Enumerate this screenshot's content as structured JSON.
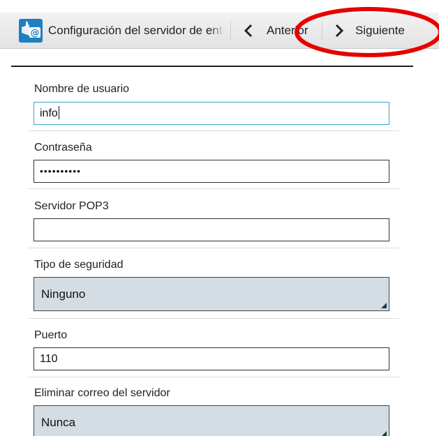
{
  "actionbar": {
    "title": "Configuración del servidor de entrada",
    "prev_label": "Anterior",
    "next_label": "Siguiente",
    "icon": "email-settings-icon"
  },
  "form": {
    "username": {
      "label": "Nombre de usuario",
      "value": "info"
    },
    "password": {
      "label": "Contraseña",
      "value": "••••••••••"
    },
    "server": {
      "label": "Servidor POP3",
      "value": ""
    },
    "security": {
      "label": "Tipo de seguridad",
      "value": "Ninguno"
    },
    "port": {
      "label": "Puerto",
      "value": "110"
    },
    "delete": {
      "label": "Eliminar correo del servidor",
      "value": "Nunca"
    }
  },
  "colors": {
    "focus": "#3aa3d8",
    "highlight": "#e60000",
    "spinner_bg": "#d4dde3",
    "app_icon": "#1f7fc0"
  }
}
